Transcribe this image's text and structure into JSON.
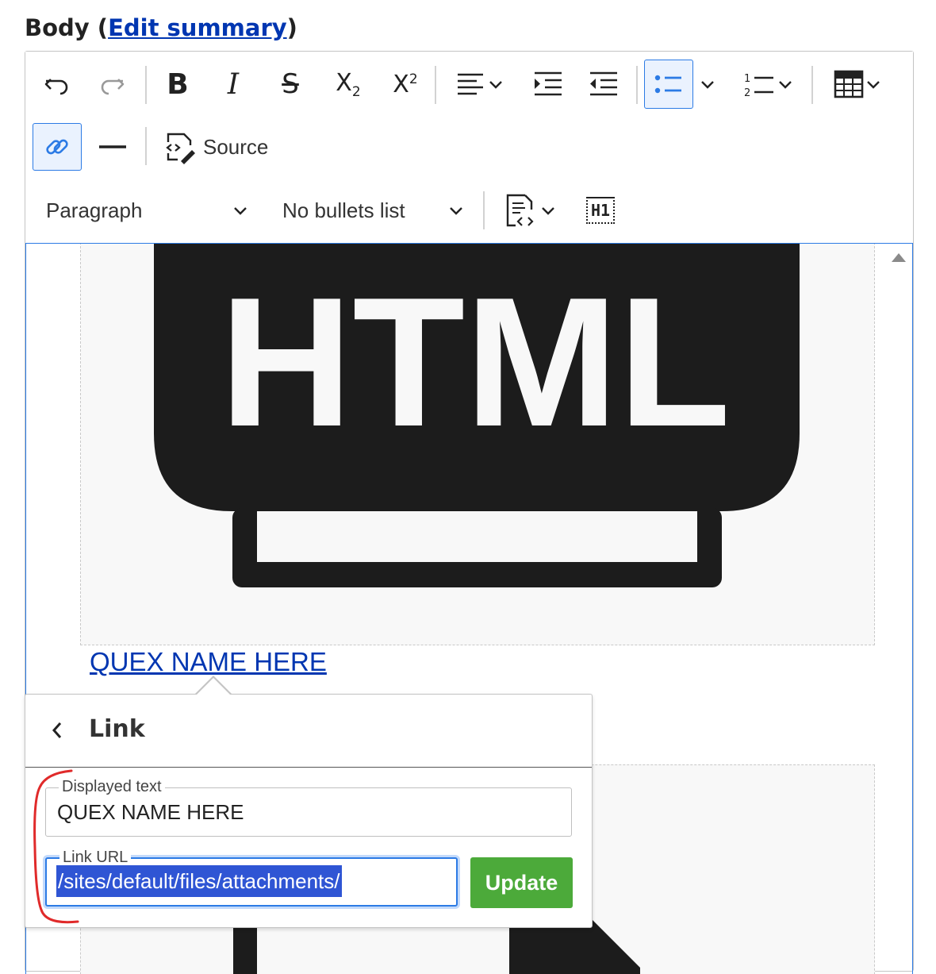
{
  "field": {
    "label": "Body",
    "paren_open": " (",
    "summary_link": "Edit summary",
    "paren_close": ")"
  },
  "toolbar": {
    "source_label": "Source",
    "heading_select": "Paragraph",
    "list_style_select": "No bullets list",
    "heading_badge": "H1",
    "active_color": "#2c7be5"
  },
  "content": {
    "image_text": "HTML",
    "link_text": "QUEX NAME HERE"
  },
  "link_balloon": {
    "title": "Link",
    "displayed_text_label": "Displayed text",
    "displayed_text_value": "QUEX NAME HERE",
    "link_url_label": "Link URL",
    "link_url_value": "/sites/default/files/attachments/",
    "update_label": "Update",
    "update_color": "#4caa3a"
  }
}
